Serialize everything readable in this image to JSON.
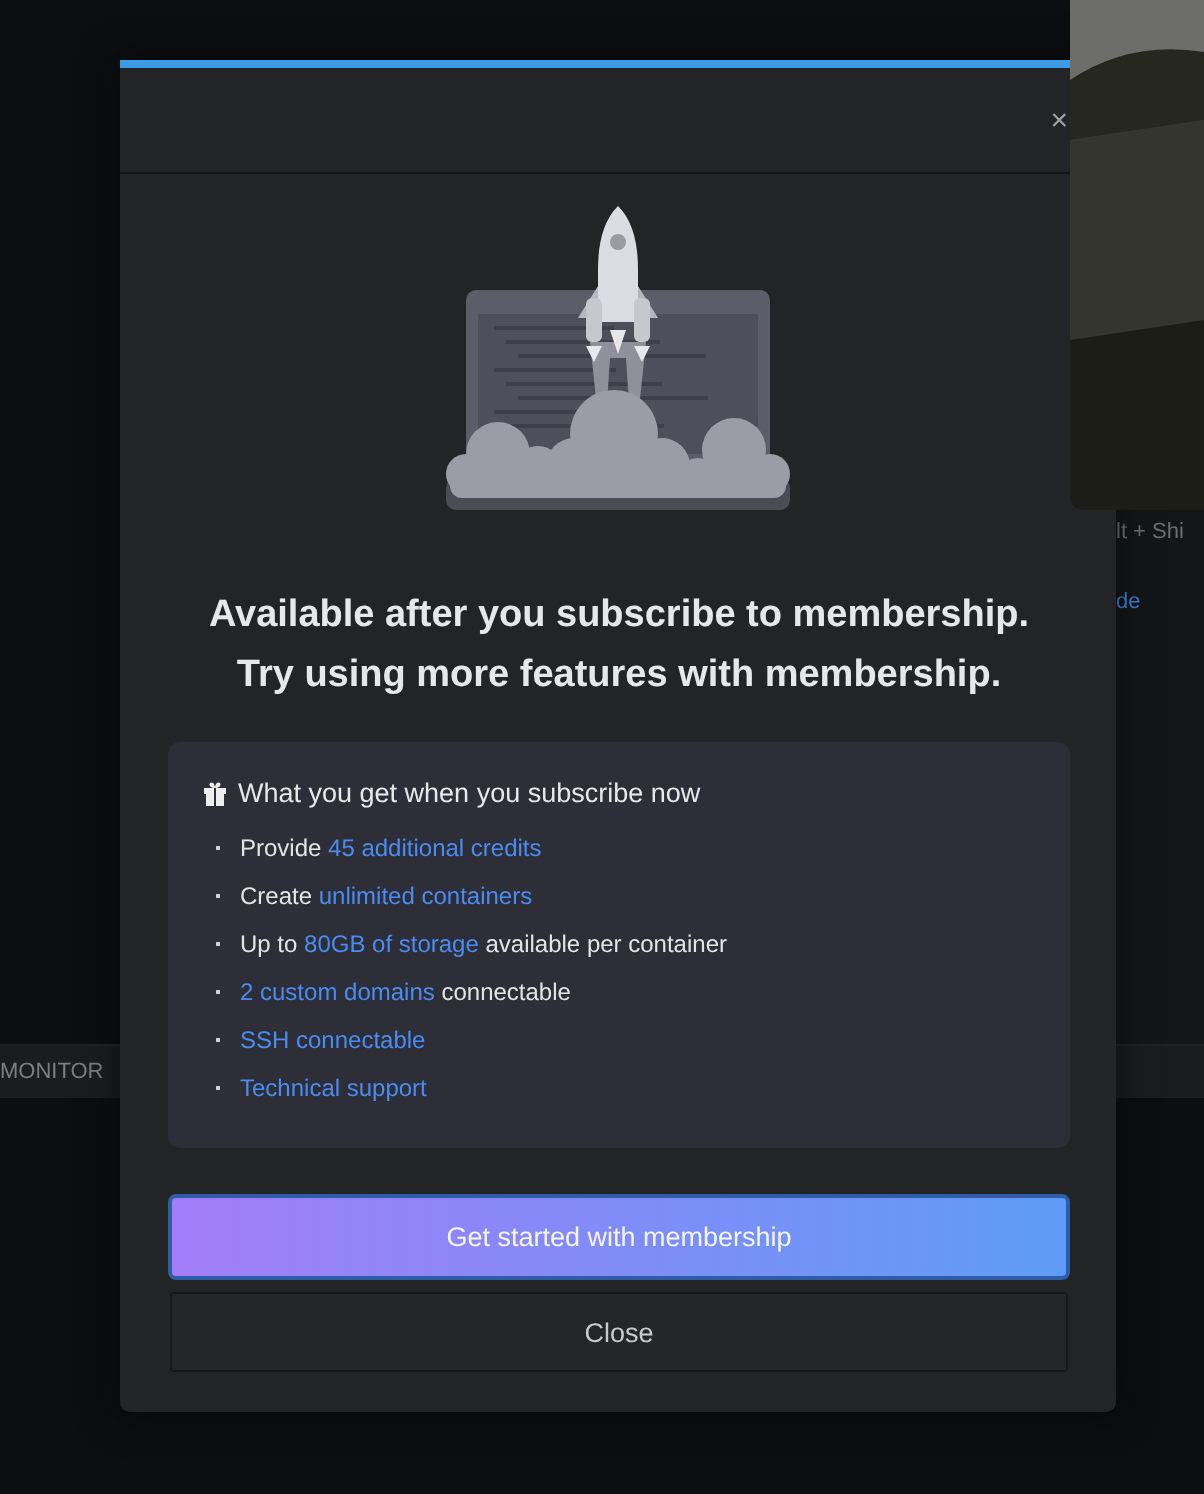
{
  "background": {
    "side_texts": [
      {
        "text": "lt + Shi",
        "kind": "hint"
      },
      {
        "text": "de",
        "kind": "link"
      }
    ],
    "bar_label": "MONITOR"
  },
  "modal": {
    "close_icon": "×",
    "headline": [
      "Available after you subscribe to membership.",
      "Try using more features with membership."
    ],
    "benefits": {
      "title": "What you get when you subscribe now",
      "items": [
        {
          "parts": [
            {
              "text": "Provide ",
              "highlight": false
            },
            {
              "text": "45 additional credits",
              "highlight": true
            }
          ]
        },
        {
          "parts": [
            {
              "text": "Create ",
              "highlight": false
            },
            {
              "text": "unlimited containers",
              "highlight": true
            }
          ]
        },
        {
          "parts": [
            {
              "text": "Up to ",
              "highlight": false
            },
            {
              "text": "80GB of storage",
              "highlight": true
            },
            {
              "text": " available per container",
              "highlight": false
            }
          ]
        },
        {
          "parts": [
            {
              "text": "2 custom domains",
              "highlight": true
            },
            {
              "text": " connectable",
              "highlight": false
            }
          ]
        },
        {
          "parts": [
            {
              "text": "SSH connectable",
              "highlight": true
            }
          ]
        },
        {
          "parts": [
            {
              "text": "Technical support",
              "highlight": true
            }
          ]
        }
      ]
    },
    "primary_button": "Get started with membership",
    "secondary_button": "Close"
  }
}
